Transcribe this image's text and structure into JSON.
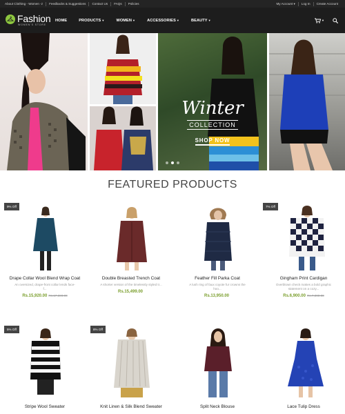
{
  "topbar": {
    "left_links": [
      "About Clothing - Women -z",
      "Feedbacks & Suggestions",
      "Contact Us",
      "FAQs",
      "Policies"
    ],
    "right_links": [
      "My Account ▾",
      "Log In",
      "Create Account"
    ]
  },
  "nav": {
    "logo_name": "Fashion",
    "logo_sub": "WOMEN'S STORE",
    "menu": [
      "HOME",
      "PRODUCTS",
      "WOMEN",
      "ACCESSORIES",
      "BEAUTY"
    ],
    "icons": [
      "cart-icon",
      "search-icon"
    ]
  },
  "hero": {
    "title": "Winter",
    "subtitle": "COLLECTION",
    "cta": "SHOP NOW",
    "slides": 3,
    "active_slide": 2
  },
  "featured": {
    "heading": "FEATURED PRODUCTS",
    "products": [
      {
        "name": "Drape Collar Wool Blend Wrap Coat",
        "desc": "An oversized, drape-front collar lends face-f...",
        "price": "Rs.15,920.00",
        "old_price": "Rs.17,690.00",
        "badge": "9% Off",
        "color": "#1d4a63"
      },
      {
        "name": "Double Breasted Trench Coat",
        "desc": "A shorter version of the timelessly styled tr...",
        "price": "Rs.15,499.00",
        "old_price": "",
        "badge": "",
        "color": "#6a2a2a"
      },
      {
        "name": "Feather Fill Parka Coat",
        "desc": "A lush ring of faux coyote fur crowns the hoo...",
        "price": "Rs.13,950.00",
        "old_price": "",
        "badge": "",
        "color": "#1f2a44"
      },
      {
        "name": "Gingham Print Cardigan",
        "desc": "Overblown check makes a bold graphic statement on a cozy...",
        "price": "Rs.6,900.00",
        "old_price": "Rs.7,390.00",
        "badge": "7% Off",
        "color": "#1f2340"
      },
      {
        "name": "Stripe Wool Sweater",
        "desc": "",
        "price": "",
        "old_price": "",
        "badge": "5% Off",
        "color": "#111111"
      },
      {
        "name": "Knit Linen & Silk Blend Sweater",
        "desc": "",
        "price": "",
        "old_price": "",
        "badge": "8% Off",
        "color": "#cfcac2"
      },
      {
        "name": "Split Neck Blouse",
        "desc": "",
        "price": "",
        "old_price": "",
        "badge": "",
        "color": "#5a1f2a"
      },
      {
        "name": "Lace Tulip Dress",
        "desc": "",
        "price": "",
        "old_price": "",
        "badge": "",
        "color": "#2443b5"
      }
    ]
  },
  "colors": {
    "accent": "#8dc63f",
    "price": "#7a9e2c",
    "nav_bg": "#1d1d1d",
    "topbar_bg": "#242424"
  }
}
